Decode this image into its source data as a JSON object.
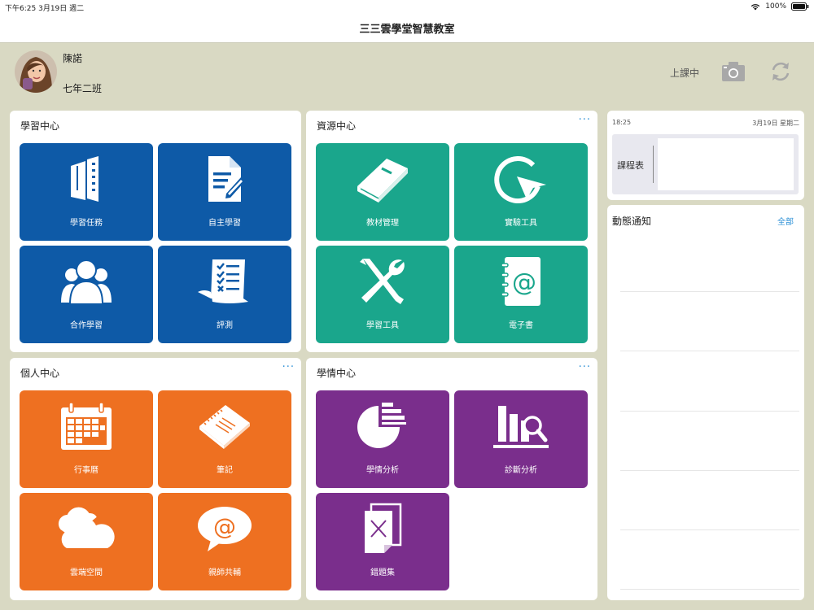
{
  "status_bar": {
    "time": "下午6:25",
    "date": "3月19日 週二",
    "battery": "100%"
  },
  "header": {
    "title": "三三雲學堂智慧教室"
  },
  "user": {
    "name": "陳諾",
    "class": "七年二班",
    "status": "上課中"
  },
  "cards": {
    "learning_center": {
      "title": "學習中心",
      "tiles": [
        "學習任務",
        "自主學習",
        "合作學習",
        "評測"
      ]
    },
    "resource_center": {
      "title": "資源中心",
      "more": "···",
      "tiles": [
        "教材管理",
        "實驗工具",
        "學習工具",
        "電子書"
      ]
    },
    "personal_center": {
      "title": "個人中心",
      "more": "···",
      "tiles": [
        "行事曆",
        "筆記",
        "雲端空間",
        "親師共輔"
      ]
    },
    "analytics_center": {
      "title": "學情中心",
      "more": "···",
      "tiles": [
        "學情分析",
        "診斷分析",
        "錯題集"
      ]
    }
  },
  "schedule": {
    "time": "18:25",
    "date": "3月19日 星期二",
    "label": "課程表"
  },
  "notices": {
    "title": "動態通知",
    "all_link": "全部"
  },
  "colors": {
    "blue": "#0e5aa7",
    "green": "#1aa68c",
    "orange": "#ee7021",
    "purple": "#7a2e8c",
    "background": "#d9d9c3",
    "link": "#2a8fd6"
  }
}
